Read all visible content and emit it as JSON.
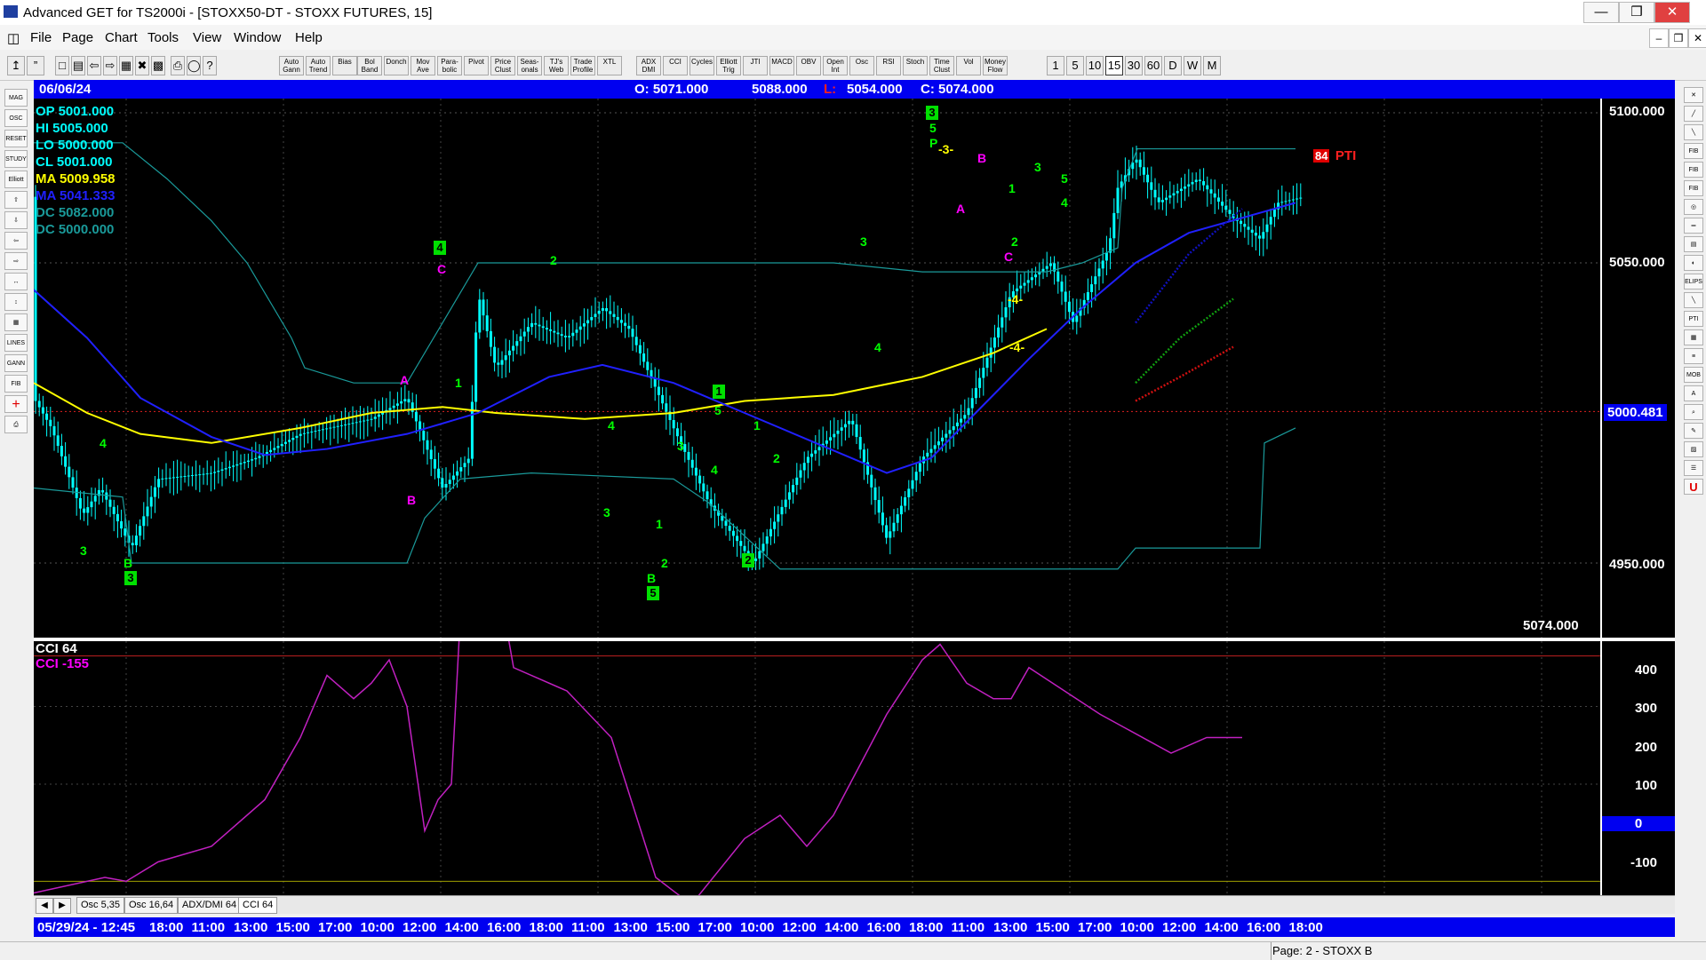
{
  "window": {
    "title": "Advanced GET for TS2000i - [STOXX50-DT - STOXX FUTURES, 15]",
    "controls": [
      "—",
      "❒",
      "✕"
    ]
  },
  "menu": [
    "File",
    "Page",
    "Chart",
    "Tools",
    "View",
    "Window",
    "Help"
  ],
  "mdi_controls": [
    "–",
    "❒",
    "✕"
  ],
  "toolbar": {
    "labeled_buttons": [
      "Auto Gann",
      "Auto Trend",
      "Bias",
      "Bol Band",
      "Donch",
      "Mov Ave",
      "Para-bolic",
      "Pivot",
      "Price Clust",
      "Seas-onals",
      "TJ's Web",
      "Trade Profile",
      "XTL",
      "ADX DMI",
      "CCI",
      "Cycles",
      "Elliott Trig",
      "JTI",
      "MACD",
      "OBV",
      "Open Int",
      "Osc",
      "RSI",
      "Stoch",
      "Time Clust",
      "Vol",
      "Money Flow"
    ],
    "intervals": [
      "1",
      "5",
      "10",
      "15",
      "30",
      "60",
      "D",
      "W",
      "M"
    ]
  },
  "left_tools": [
    "MAG",
    "OSC",
    "RESET",
    "STUDY",
    "Elliott",
    "⇧",
    "⇩",
    "⇦",
    "⇨",
    "↔",
    "↕",
    "▦",
    "LINES",
    "GANN",
    "FIB",
    "+",
    "⎙"
  ],
  "right_tools": [
    "✕",
    "╱",
    "╲",
    "FIB RET",
    "FIB EXT",
    "FIB TIME",
    "◎",
    "═",
    "▤",
    "◐",
    "ELIPS",
    "╲",
    "PTI",
    "▦",
    "≡",
    "MOB",
    "A",
    "⌕",
    "✎",
    "▨",
    "☰",
    "U"
  ],
  "header": {
    "date": "06/06/24",
    "open": "O: 5071.000",
    "high": "5088.000",
    "low_label": "L:",
    "low": "5054.000",
    "close": "C: 5074.000"
  },
  "indicators": [
    {
      "label": "OP  5001.000",
      "color": "#00ffff"
    },
    {
      "label": "HI   5005.000",
      "color": "#00ffff"
    },
    {
      "label": "LO   5000.000",
      "color": "#00ffff"
    },
    {
      "label": "CL   5001.000",
      "color": "#00ffff"
    },
    {
      "label": "MA  5009.958",
      "color": "#ffff00"
    },
    {
      "label": "MA  5041.333",
      "color": "#2020ff"
    },
    {
      "label": "DC  5082.000",
      "color": "#1a9a9a"
    },
    {
      "label": "DC  5000.000",
      "color": "#1a9a9a"
    }
  ],
  "price_axis": {
    "labels": [
      "5100.000",
      "5050.000",
      "5000.481",
      "4950.000"
    ],
    "current": "5000.481",
    "last": "5074.000"
  },
  "pti": {
    "value": "84",
    "label": "PTI"
  },
  "elliott_labels": [
    {
      "t": "3",
      "c": "#00ff00",
      "p": 4954
    },
    {
      "t": "B",
      "c": "#00ff00",
      "p": 4950
    },
    {
      "t": "4",
      "c": "#00ff00",
      "p": 4990
    },
    {
      "t": "A",
      "c": "#ff00ff",
      "p": 5011
    },
    {
      "t": "B",
      "c": "#ff00ff",
      "p": 4971
    },
    {
      "t": "C",
      "c": "#ff00ff",
      "p": 5048
    },
    {
      "t": "1",
      "c": "#00ff00",
      "p": 5010
    },
    {
      "t": "2",
      "c": "#00ff00",
      "p": 5051
    },
    {
      "t": "4",
      "c": "#00ff00",
      "p": 4996
    },
    {
      "t": "3",
      "c": "#00ff00",
      "p": 4967
    },
    {
      "t": "1",
      "c": "#00ff00",
      "p": 4963
    },
    {
      "t": "2",
      "c": "#00ff00",
      "p": 4950
    },
    {
      "t": "B",
      "c": "#00ff00",
      "p": 4945
    },
    {
      "t": "3",
      "c": "#00ff00",
      "p": 4989
    },
    {
      "t": "5",
      "c": "#00ff00",
      "p": 5001
    },
    {
      "t": "4",
      "c": "#00ff00",
      "p": 4981
    },
    {
      "t": "1",
      "c": "#00ff00",
      "p": 4996
    },
    {
      "t": "2",
      "c": "#00ff00",
      "p": 4985
    },
    {
      "t": "3",
      "c": "#00ff00",
      "p": 5057
    },
    {
      "t": "4",
      "c": "#00ff00",
      "p": 5022
    },
    {
      "t": "5",
      "c": "#00ff00",
      "p": 5095
    },
    {
      "t": "P",
      "c": "#00ff00",
      "p": 5090
    },
    {
      "t": "-3-",
      "c": "#ffff00",
      "p": 5088
    },
    {
      "t": "A",
      "c": "#ff00ff",
      "p": 5068
    },
    {
      "t": "B",
      "c": "#ff00ff",
      "p": 5085
    },
    {
      "t": "1",
      "c": "#00ff00",
      "p": 5075
    },
    {
      "t": "2",
      "c": "#00ff00",
      "p": 5057
    },
    {
      "t": "C",
      "c": "#ff00ff",
      "p": 5052
    },
    {
      "t": "3",
      "c": "#00ff00",
      "p": 5082
    },
    {
      "t": "5",
      "c": "#00ff00",
      "p": 5078
    },
    {
      "t": "4",
      "c": "#00ff00",
      "p": 5070
    },
    {
      "t": "-4-",
      "c": "#ffff00",
      "p": 5038
    },
    {
      "t": "-4-",
      "c": "#ffff00",
      "p": 5022
    }
  ],
  "elliott_boxes": [
    {
      "t": "3",
      "p": 4945
    },
    {
      "t": "4",
      "p": 5055
    },
    {
      "t": "5",
      "p": 4940
    },
    {
      "t": "2",
      "p": 4951
    },
    {
      "t": "1",
      "p": 5007
    },
    {
      "t": "3",
      "p": 5100
    }
  ],
  "cci": {
    "title": "CCI 64",
    "value_label": "CCI  -155",
    "axis_labels": [
      "400",
      "300",
      "200",
      "100",
      "-100"
    ],
    "zero_label": "0"
  },
  "tabs": [
    "Osc 5,35",
    "Osc 16,64",
    "ADX/DMI 64",
    "CCI 64"
  ],
  "time_axis": {
    "start": "05/29/24 - 12:45",
    "labels": [
      "18:00",
      "11:00",
      "13:00",
      "15:00",
      "17:00",
      "10:00",
      "12:00",
      "14:00",
      "16:00",
      "18:00",
      "11:00",
      "13:00",
      "15:00",
      "17:00",
      "10:00",
      "12:00",
      "14:00",
      "16:00",
      "18:00",
      "11:00",
      "13:00",
      "15:00",
      "17:00",
      "10:00",
      "12:00",
      "14:00",
      "16:00",
      "18:00"
    ]
  },
  "status": "Page: 2 - STOXX B"
}
